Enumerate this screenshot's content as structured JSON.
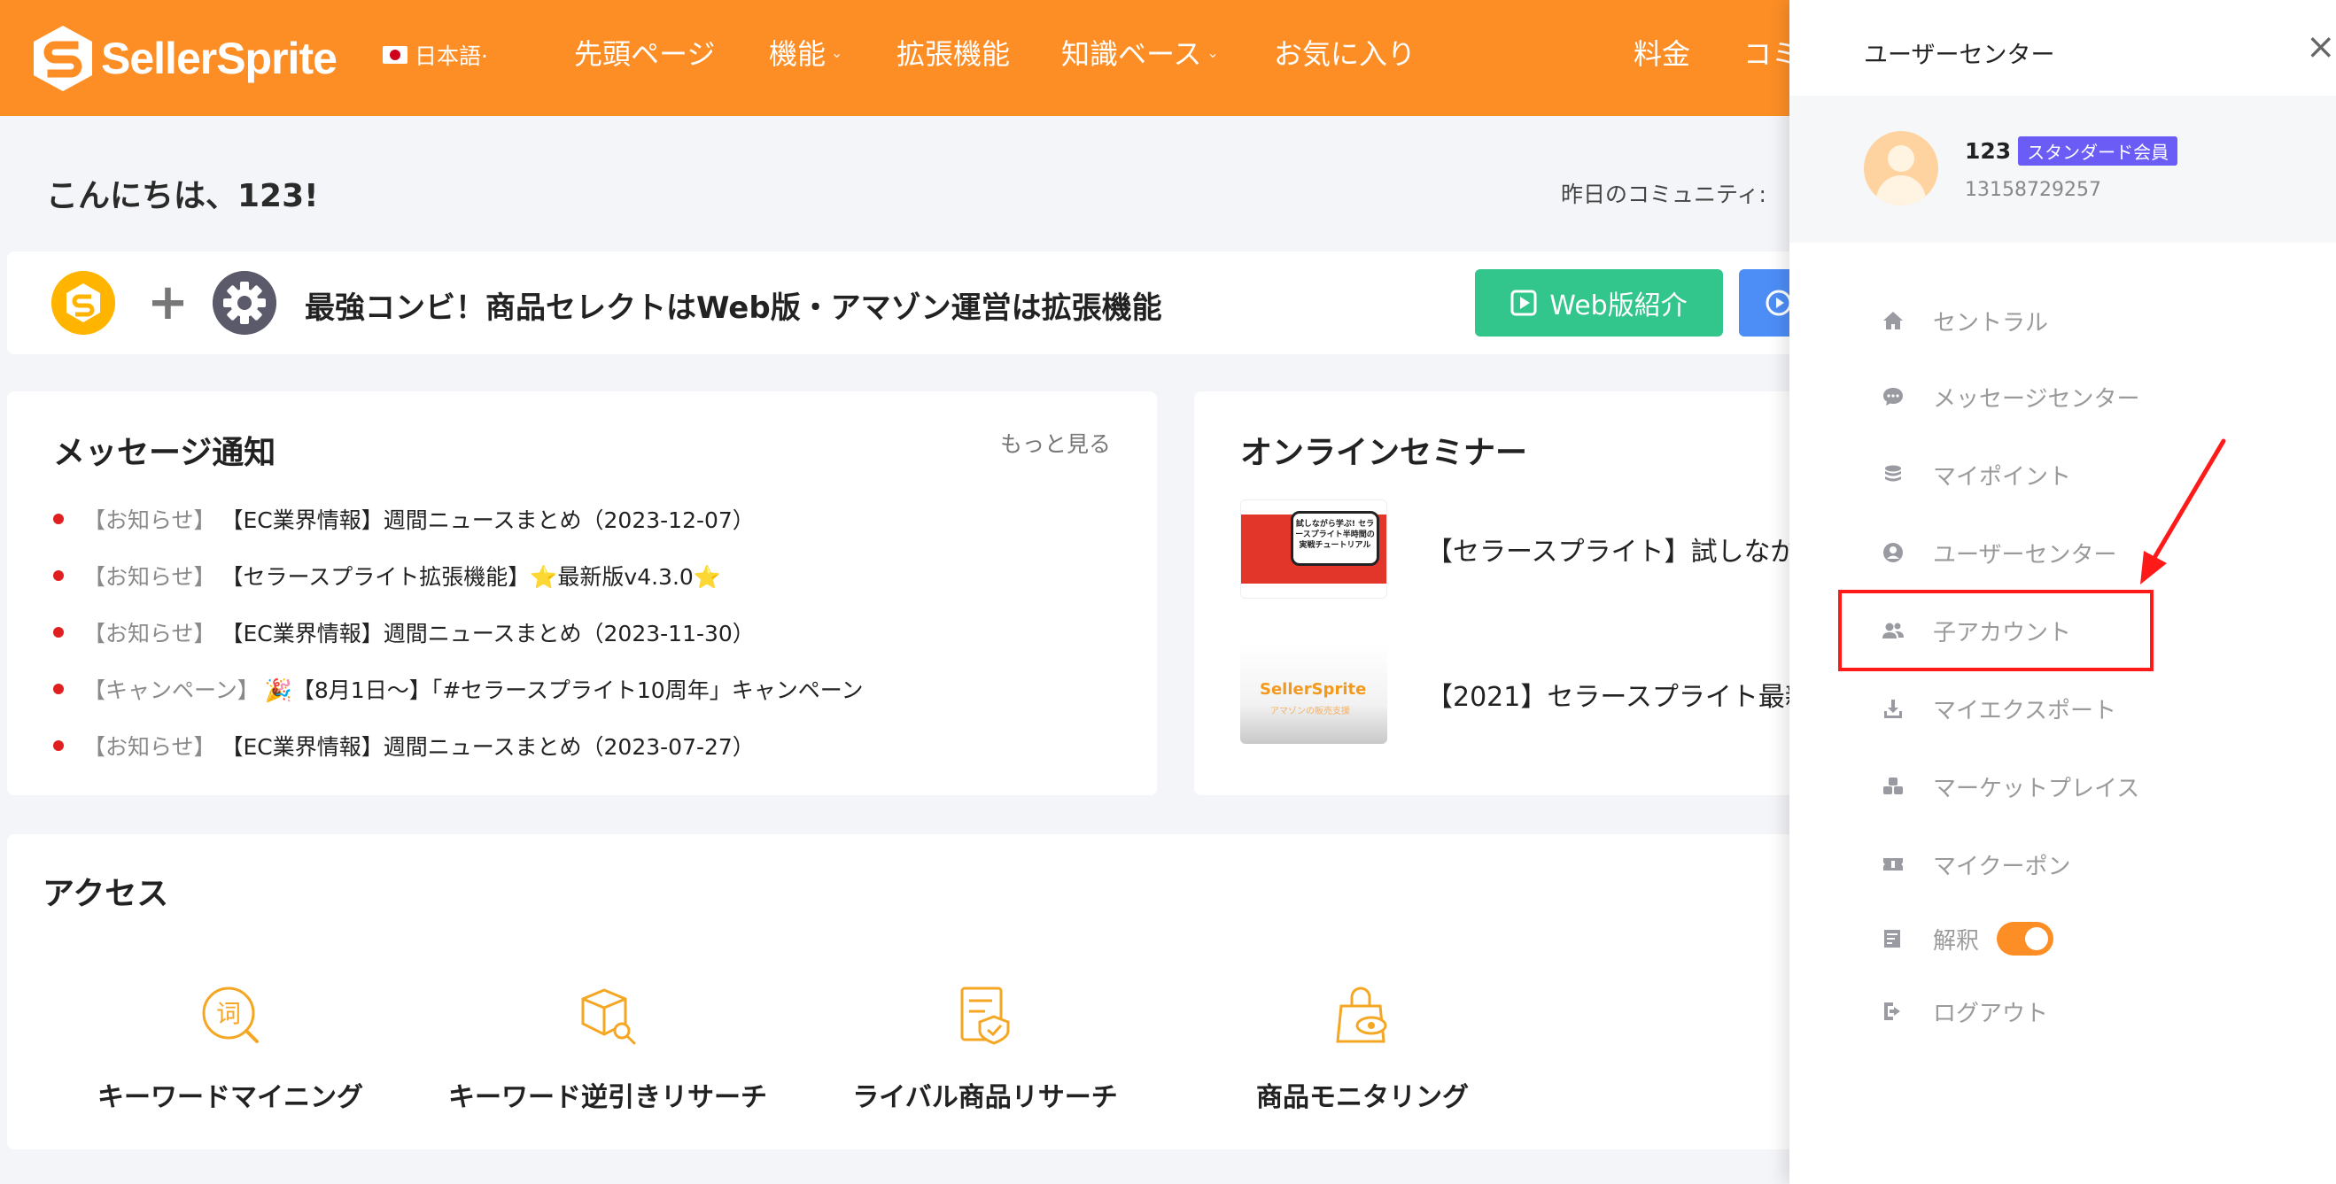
{
  "header": {
    "brand": "SellerSprite",
    "language": "日本語·",
    "nav": [
      {
        "label": "先頭ページ",
        "caret": false
      },
      {
        "label": "機能",
        "caret": true
      },
      {
        "label": "拡張機能",
        "caret": false
      },
      {
        "label": "知識ベース",
        "caret": true
      },
      {
        "label": "お気に入り",
        "caret": false
      },
      {
        "label": "料金",
        "caret": false
      },
      {
        "label": "コミ",
        "caret": false
      }
    ]
  },
  "greeting": "こんにちは、123!",
  "community_label": "昨日のコミュニティ:",
  "banner": {
    "plus": "+",
    "text": "最強コンビ！商品セレクトはWeb版・アマゾン運営は拡張機能",
    "web_button": "Web版紹介"
  },
  "messages": {
    "title": "メッセージ通知",
    "more": "もっと見る",
    "items": [
      {
        "tag": "【お知らせ】",
        "text": "【EC業界情報】週間ニュースまとめ（2023-12-07）"
      },
      {
        "tag": "【お知らせ】",
        "text": "【セラースプライト拡張機能】⭐最新版v4.3.0⭐"
      },
      {
        "tag": "【お知らせ】",
        "text": "【EC業界情報】週間ニュースまとめ（2023-11-30）"
      },
      {
        "tag": "【キャンペーン】",
        "text": "🎉【8月1日～】「#セラースプライト10周年」キャンペーン"
      },
      {
        "tag": "【お知らせ】",
        "text": "【EC業界情報】週間ニュースまとめ（2023-07-27）"
      }
    ]
  },
  "seminar": {
    "title": "オンラインセミナー",
    "items": [
      {
        "text": "【セラースプライト】試しなが",
        "thumb_text": "試しながら学ぶ! セラースプライト半時間の実戦チュートリアル"
      },
      {
        "text": "【2021】セラースプライト最新",
        "thumb_text": "SellerSprite",
        "thumb_sub": "アマゾンの販売支援"
      }
    ]
  },
  "access": {
    "title": "アクセス",
    "items": [
      {
        "label": "キーワードマイニング",
        "icon": "keyword-mining-icon",
        "glyph": "词"
      },
      {
        "label": "キーワード逆引きリサーチ",
        "icon": "reverse-search-icon"
      },
      {
        "label": "ライバル商品リサーチ",
        "icon": "competitor-research-icon"
      },
      {
        "label": "商品モニタリング",
        "icon": "product-monitoring-icon"
      }
    ]
  },
  "drawer": {
    "title": "ユーザーセンター",
    "close": "×",
    "user": {
      "name": "123",
      "badge": "スタンダード会員",
      "phone": "13158729257"
    },
    "menu": [
      {
        "label": "セントラル",
        "icon": "home-icon"
      },
      {
        "label": "メッセージセンター",
        "icon": "chat-icon"
      },
      {
        "label": "マイポイント",
        "icon": "coins-icon"
      },
      {
        "label": "ユーザーセンター",
        "icon": "user-circle-icon"
      },
      {
        "label": "子アカウント",
        "icon": "users-icon"
      },
      {
        "label": "マイエクスポート",
        "icon": "download-icon"
      },
      {
        "label": "マーケットプレイス",
        "icon": "marketplace-icon"
      },
      {
        "label": "マイクーポン",
        "icon": "coupon-icon"
      },
      {
        "label": "解釈",
        "icon": "translate-icon",
        "toggle": true
      },
      {
        "label": "ログアウト",
        "icon": "logout-icon"
      }
    ]
  },
  "colors": {
    "brand": "#fd8e25",
    "web_button": "#32c58c",
    "badge": "#6a5cf5",
    "highlight": "#ff1a1a"
  }
}
